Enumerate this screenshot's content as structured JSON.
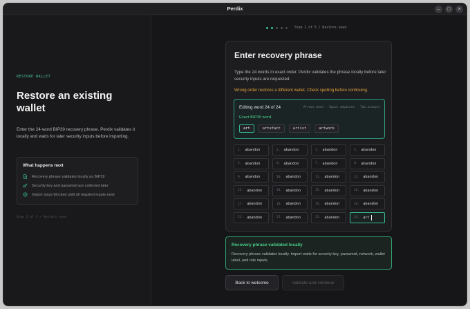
{
  "window": {
    "title": "Perdix"
  },
  "controls": {
    "minimize": "–",
    "maximize": "□",
    "close": "×"
  },
  "left": {
    "eyebrow": "RESTORE WALLET",
    "title": "Restore an existing wallet",
    "lead": "Enter the 24-word BIP39 recovery phrase. Perdix validates it locally and waits for later security inputs before importing.",
    "info": {
      "title": "What happens next",
      "items": [
        {
          "icon": "document-icon",
          "text": "Recovery phrase validates locally as BIP39"
        },
        {
          "icon": "key-icon",
          "text": "Security key and password are collected later"
        },
        {
          "icon": "shield-check-icon",
          "text": "Import stays blocked until all required inputs exist"
        }
      ]
    },
    "footer": "Step 2 of 5 / Restore seed"
  },
  "stepper": {
    "text": "Step 2 of 5 / Restore seed",
    "total": 5,
    "current": 2
  },
  "card": {
    "title": "Enter recovery phrase",
    "description": "Type the 24 words in exact order. Perdix validates the phrase locally before later security inputs are requested.",
    "warning": "Wrong order restores a different wallet. Check spelling before continuing.",
    "editor": {
      "title": "Editing word 24 of 24",
      "hint": "Arrows move · Space advances · Tab accepts",
      "match": "Exact BIP39 word.",
      "suggestions": [
        "art",
        "artefact",
        "artist",
        "artwork"
      ]
    },
    "words": [
      {
        "n": "1.",
        "w": "abandon"
      },
      {
        "n": "2.",
        "w": "abandon"
      },
      {
        "n": "3.",
        "w": "abandon"
      },
      {
        "n": "4.",
        "w": "abandon"
      },
      {
        "n": "5.",
        "w": "abandon"
      },
      {
        "n": "6.",
        "w": "abandon"
      },
      {
        "n": "7.",
        "w": "abandon"
      },
      {
        "n": "8.",
        "w": "abandon"
      },
      {
        "n": "9.",
        "w": "abandon"
      },
      {
        "n": "10.",
        "w": "abandon"
      },
      {
        "n": "11.",
        "w": "abandon"
      },
      {
        "n": "12.",
        "w": "abandon"
      },
      {
        "n": "13.",
        "w": "abandon"
      },
      {
        "n": "14.",
        "w": "abandon"
      },
      {
        "n": "15.",
        "w": "abandon"
      },
      {
        "n": "16.",
        "w": "abandon"
      },
      {
        "n": "17.",
        "w": "abandon"
      },
      {
        "n": "18.",
        "w": "abandon"
      },
      {
        "n": "19.",
        "w": "abandon"
      },
      {
        "n": "20.",
        "w": "abandon"
      },
      {
        "n": "21.",
        "w": "abandon"
      },
      {
        "n": "22.",
        "w": "abandon"
      },
      {
        "n": "23.",
        "w": "abandon"
      },
      {
        "n": "24.",
        "w": "art"
      }
    ]
  },
  "success": {
    "title": "Recovery phrase validated locally",
    "text": "Recovery phrase validates locally. Import waits for security key, password, network, wallet label, and role inputs."
  },
  "buttons": {
    "back": "Back to welcome",
    "next": "Validate and continue"
  },
  "colors": {
    "accent": "#38c2a0",
    "warning": "#e0a23a",
    "success": "#4ad08b"
  }
}
